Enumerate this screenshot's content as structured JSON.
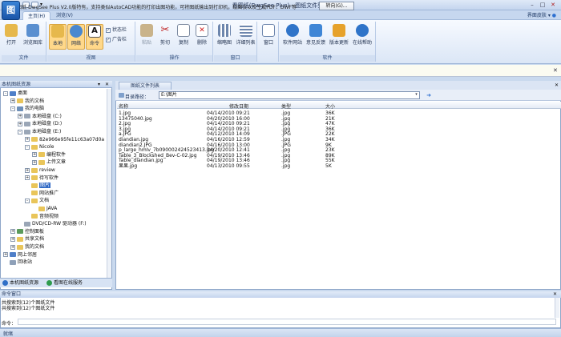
{
  "window": {
    "title": "看图纸(DwgSee Plus) - 图纸文件列表",
    "min": "–",
    "max": "□",
    "close": "✕"
  },
  "ribbon": {
    "tabs": [
      "主页(H)",
      "浏览(V)"
    ],
    "skin_label": "界面皮肤",
    "groups": [
      {
        "label": "文件",
        "buttons": [
          "打开",
          "浏览图库"
        ]
      },
      {
        "label": "视图",
        "buttons": [
          "本地",
          "网络",
          "命令"
        ],
        "checks": [
          "状态栏",
          "广告栏"
        ]
      },
      {
        "label": "操作",
        "buttons": [
          "粘贴",
          "剪切",
          "复制",
          "删除"
        ]
      },
      {
        "label": "窗口",
        "buttons": [
          "缩略图",
          "详细列表"
        ]
      },
      {
        "label": "",
        "buttons": [
          "窗口"
        ]
      },
      {
        "label": "软件",
        "buttons": [
          "软件网站",
          "意见反馈",
          "版本更新",
          "在线帮助"
        ]
      }
    ]
  },
  "infobar": {
    "text": "看图纸-DwgSee Plus V2.0版特有，支持类似AutoCAD功能的打印出图功能，可将图纸输出到打印机，绘图仪以及生成PDF、DWF等",
    "button": "转向(G)..."
  },
  "left_panel": {
    "title": "本机图纸资源",
    "tree": [
      {
        "label": "桌面",
        "level": 0,
        "exp": "-",
        "color": "#4f7fc8"
      },
      {
        "label": "我的文档",
        "level": 1,
        "exp": "+",
        "color": "#e9c55a"
      },
      {
        "label": "我的电脑",
        "level": 1,
        "exp": "-",
        "color": "#6d8fb8"
      },
      {
        "label": "本地磁盘 (C:)",
        "level": 2,
        "exp": "+",
        "color": "#9aa6b6"
      },
      {
        "label": "本地磁盘 (D:)",
        "level": 2,
        "exp": "+",
        "color": "#9aa6b6"
      },
      {
        "label": "本地磁盘 (E:)",
        "level": 2,
        "exp": "-",
        "color": "#9aa6b6"
      },
      {
        "label": "82e966e95fe11c63a07d0a",
        "level": 3,
        "exp": "+",
        "color": "#e9c55a"
      },
      {
        "label": "Nicole",
        "level": 3,
        "exp": "-",
        "color": "#e9c55a"
      },
      {
        "label": "编程软件",
        "level": 4,
        "exp": "+",
        "color": "#e9c55a"
      },
      {
        "label": "上传文章",
        "level": 4,
        "exp": "+",
        "color": "#e9c55a"
      },
      {
        "label": "review",
        "level": 3,
        "exp": "+",
        "color": "#e9c55a"
      },
      {
        "label": "待写软件",
        "level": 3,
        "exp": "+",
        "color": "#e9c55a"
      },
      {
        "label": "图片",
        "level": 3,
        "exp": "",
        "color": "#e9c55a",
        "selected": true
      },
      {
        "label": "网站推广",
        "level": 3,
        "exp": "",
        "color": "#e9c55a"
      },
      {
        "label": "文档",
        "level": 3,
        "exp": "-",
        "color": "#e9c55a"
      },
      {
        "label": "JAVA",
        "level": 4,
        "exp": "",
        "color": "#e9c55a"
      },
      {
        "label": "音频视频",
        "level": 3,
        "exp": "",
        "color": "#e9c55a"
      },
      {
        "label": "DVD/CD-RW 驱动器 (F:)",
        "level": 2,
        "exp": "",
        "color": "#9aa6b6"
      },
      {
        "label": "控制面板",
        "level": 1,
        "exp": "+",
        "color": "#5b9a5b"
      },
      {
        "label": "共享文档",
        "level": 1,
        "exp": "+",
        "color": "#e9c55a"
      },
      {
        "label": "我的文档",
        "level": 1,
        "exp": "+",
        "color": "#e9c55a"
      },
      {
        "label": "网上邻居",
        "level": 0,
        "exp": "+",
        "color": "#4f7fc8"
      },
      {
        "label": "回收站",
        "level": 0,
        "exp": "",
        "color": "#8ea0b8"
      }
    ],
    "tabs": [
      "本机图纸资源",
      "看图在线服务"
    ]
  },
  "right_panel": {
    "tab": "图纸文件列表",
    "path_label": "目录路径：",
    "path_value": "E:\\图片",
    "columns": [
      "名称",
      "修改日期",
      "类型",
      "大小"
    ],
    "files": [
      [
        "1.jpg",
        "04/14/2010 09:21",
        ".jpg",
        "36K"
      ],
      [
        "13475040.jpg",
        "04/20/2010 16:00",
        ".jpg",
        "21K"
      ],
      [
        "2.jpg",
        "04/14/2010 09:21",
        ".jpg",
        "47K"
      ],
      [
        "3.jpg",
        "04/14/2010 09:21",
        ".jpg",
        "36K"
      ],
      [
        "a.JPG",
        "04/12/2010 14:09",
        ".JPG",
        "22K"
      ],
      [
        "diandian.jpg",
        "04/16/2010 12:59",
        ".jpg",
        "34K"
      ],
      [
        "diandian2.JPG",
        "04/16/2010 13:00",
        ".JPG",
        "9K"
      ],
      [
        "p_large_hmIv_7b090002424523413.jpg",
        "04/20/2010 12:41",
        ".jpg",
        "23K"
      ],
      [
        "Table_3_Blockshed_Bev-C-02.jpg",
        "04/19/2010 13:46",
        ".jpg",
        "89K"
      ],
      [
        "Table_diandian.jpg",
        "04/19/2010 13:46",
        ".jpg",
        "55K"
      ],
      [
        "果果.jpg",
        "04/13/2010 09:55",
        ".jpg",
        "5K"
      ]
    ]
  },
  "command": {
    "title": "命令窗口",
    "lines": [
      "共搜索到(12)个图纸文件",
      "共搜索到(12)个图纸文件"
    ],
    "prompt": "命令："
  },
  "status": {
    "text": "就绪"
  }
}
